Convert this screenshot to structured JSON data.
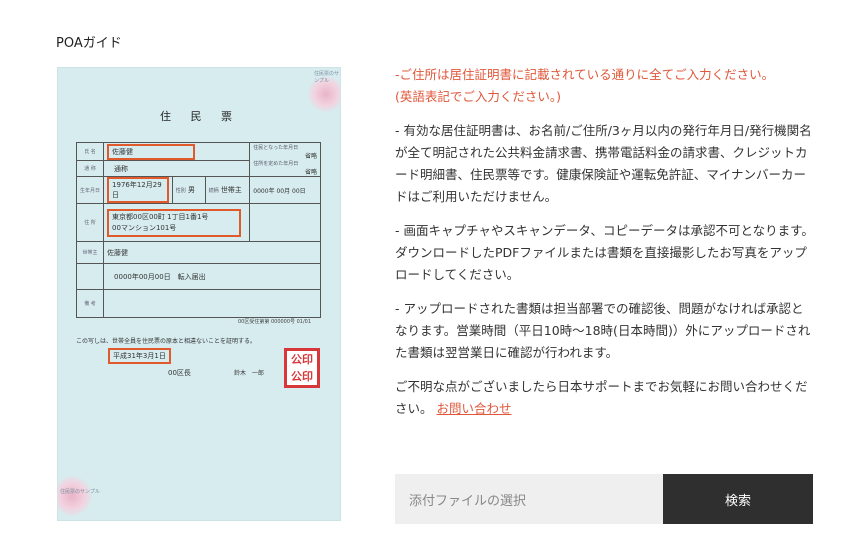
{
  "page": {
    "title": "POAガイド"
  },
  "document": {
    "corner_stamp": "住民票のサンプル",
    "title": "住 民 票",
    "name_label": "氏 名",
    "name_value": "佐藤健",
    "alias_label": "通 称",
    "alias_value": "通称",
    "top_right_1": "省略",
    "top_right_2": "省略",
    "top_right_note_1": "住民となった年月日",
    "top_right_note_2": "住所を定めた年月日",
    "birth_label": "生年月日",
    "birth_value": "1976年12月29日",
    "sex_label": "性別",
    "sex_value": "男",
    "relation_label": "続柄",
    "relation_value": "世帯主",
    "date_right": "0000年 00月 00日",
    "address_label": "住 所",
    "address_line1": "東京都00区00町 1丁目1番1号",
    "address_line2": "00マンション101号",
    "head_label": "世帯主",
    "head_value": "佐藤健",
    "move_in": "0000年00月00日　転入届出",
    "remarks_label": "備 考",
    "doc_number": "00区受住第第 000000号 01/01",
    "certify_text": "この写しは、世帯全員を住民票の原本と相違ないことを証明する。",
    "issue_date": "平成31年3月1日",
    "ward_head": "00区長",
    "mayor_name": "鈴木　一郎",
    "seal_text_1": "公印",
    "seal_text_2": "公印",
    "bottom_stamp": "住民票のサンプル"
  },
  "instructions": {
    "p1_line1": "-ご住所は居住証明書に記載されている通りに全てご入力ください。",
    "p1_line2": "(英語表記でご入力ください。)",
    "p2": "- 有効な居住証明書は、お名前/ご住所/3ヶ月以内の発行年月日/発行機関名が全て明記された公共料金請求書、携帯電話料金の請求書、クレジットカード明細書、住民票等です。健康保険証や運転免許証、マイナンバーカードはご利用いただけません。",
    "p3": "- 画面キャプチャやスキャンデータ、コピーデータは承認不可となります。ダウンロードしたPDFファイルまたは書類を直接撮影したお写真をアップロードしてください。",
    "p4": "- アップロードされた書類は担当部署での確認後、問題がなければ承認となります。営業時間（平日10時～18時(日本時間)）外にアップロードされた書類は翌営業日に確認が行われます。",
    "p5_text": "ご不明な点がございましたら日本サポートまでお気軽にお問い合わせください。",
    "contact_link": "お問い合わせ"
  },
  "upload": {
    "file_placeholder": "添付ファイルの選択",
    "search_label": "検索"
  },
  "colors": {
    "accent": "#e0573a",
    "button_bg": "#2f2f2f",
    "highlight": "#e05a2c",
    "seal": "#d8373a"
  }
}
